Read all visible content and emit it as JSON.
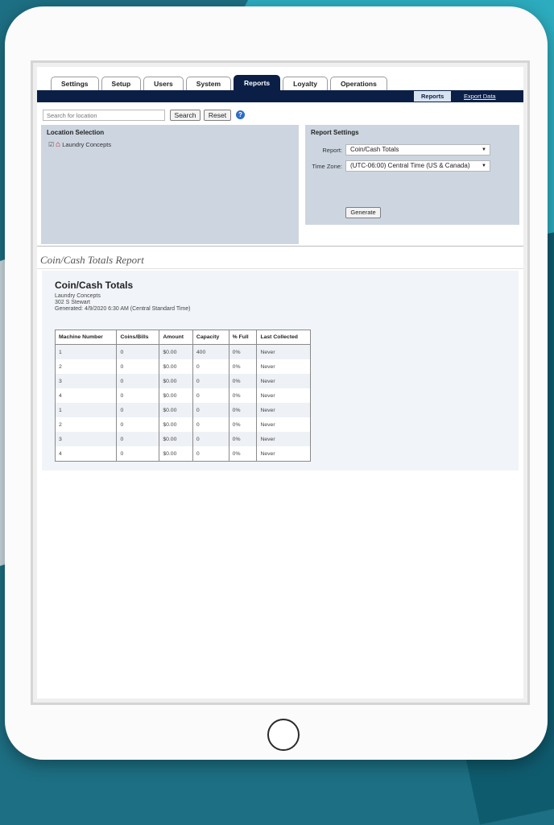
{
  "tabs": [
    "Settings",
    "Setup",
    "Users",
    "System",
    "Reports",
    "Loyalty",
    "Operations"
  ],
  "active_tab": "Reports",
  "subnav": {
    "active": "Reports",
    "link": "Export Data"
  },
  "search": {
    "placeholder": "Search for location",
    "search_label": "Search",
    "reset_label": "Reset",
    "help": "?"
  },
  "location_panel": {
    "title": "Location Selection",
    "location": "Laundry Concepts"
  },
  "report_settings": {
    "title": "Report Settings",
    "report_label": "Report:",
    "report_value": "Coin/Cash Totals",
    "timezone_label": "Time Zone:",
    "timezone_value": "(UTC-06:00) Central Time (US & Canada)",
    "generate_label": "Generate"
  },
  "report_heading": "Coin/Cash Totals Report",
  "report": {
    "title": "Coin/Cash Totals",
    "company": "Laundry Concepts",
    "address": "302 S Stewart",
    "generated": "Generated: 4/9/2020 6:30 AM (Central Standard Time)",
    "columns": [
      "Machine Number",
      "Coins/Bills",
      "Amount",
      "Capacity",
      "% Full",
      "Last Collected"
    ],
    "rows": [
      [
        "1",
        "0",
        "$0.00",
        "400",
        "0%",
        "Never"
      ],
      [
        "2",
        "0",
        "$0.00",
        "0",
        "0%",
        "Never"
      ],
      [
        "3",
        "0",
        "$0.00",
        "0",
        "0%",
        "Never"
      ],
      [
        "4",
        "0",
        "$0.00",
        "0",
        "0%",
        "Never"
      ],
      [
        "1",
        "0",
        "$0.00",
        "0",
        "0%",
        "Never"
      ],
      [
        "2",
        "0",
        "$0.00",
        "0",
        "0%",
        "Never"
      ],
      [
        "3",
        "0",
        "$0.00",
        "0",
        "0%",
        "Never"
      ],
      [
        "4",
        "0",
        "$0.00",
        "0",
        "0%",
        "Never"
      ]
    ]
  },
  "colors": {
    "navy": "#0b1f46",
    "panel": "#cdd6e0",
    "accent": "#2fb7c9",
    "house": "#c9121b"
  }
}
